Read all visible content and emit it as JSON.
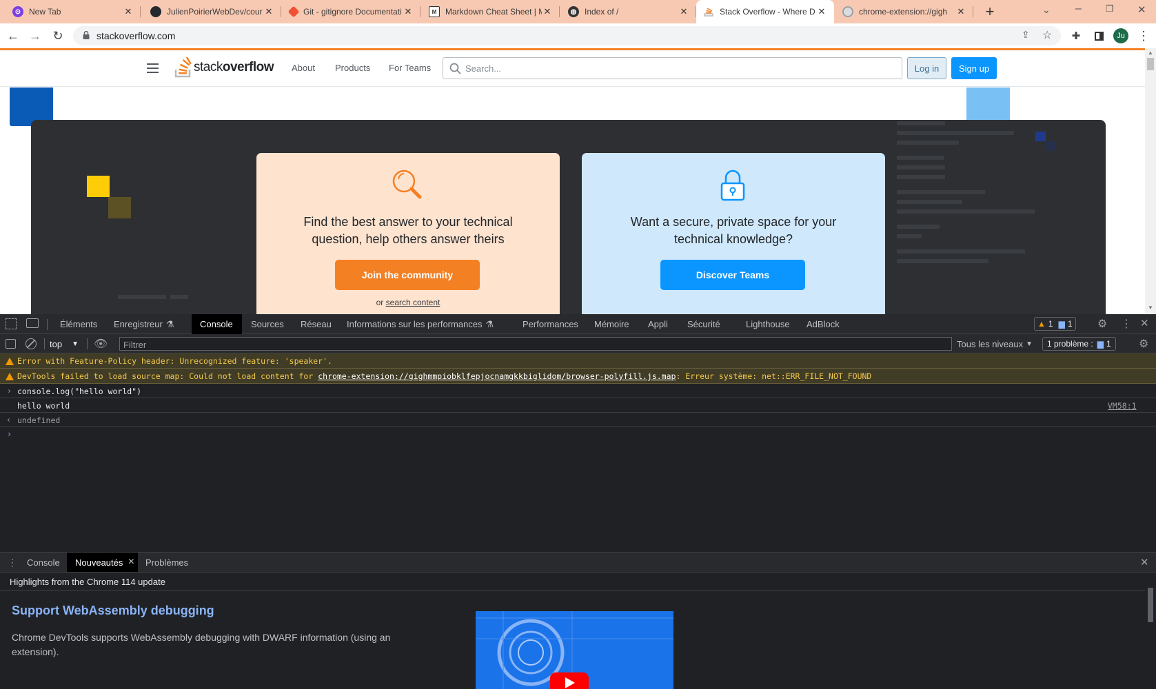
{
  "browser": {
    "tabs": [
      {
        "title": "New Tab",
        "fav_color": "#7b3fe4"
      },
      {
        "title": "JulienPoirierWebDev/cour",
        "fav_color": "#24292f"
      },
      {
        "title": "Git - gitignore Documentati",
        "fav_color": "#f05033"
      },
      {
        "title": "Markdown Cheat Sheet | M",
        "fav_color": "#333333"
      },
      {
        "title": "Index of /",
        "fav_color": "#333333"
      },
      {
        "title": "Stack Overflow - Where D",
        "fav_color": "#f48024"
      },
      {
        "title": "chrome-extension://gigh",
        "fav_color": "#9aa0a6"
      }
    ],
    "new_tab": "+",
    "url": "stackoverflow.com",
    "profile_initials": "Ju"
  },
  "so": {
    "logo_text_a": "stack",
    "logo_text_b": "overflow",
    "nav": [
      "About",
      "Products",
      "For Teams"
    ],
    "search_placeholder": "Search...",
    "login": "Log in",
    "signup": "Sign up",
    "card1": {
      "text": "Find the best answer to your technical question, help others answer theirs",
      "cta": "Join the community",
      "or": "or",
      "link": "search content",
      "bg": "#fee3cf",
      "cta_color": "#f48024"
    },
    "card2": {
      "text": "Want a secure, private space for your technical knowledge?",
      "cta": "Discover Teams",
      "bg": "#cfe8fc",
      "cta_color": "#0a95ff"
    }
  },
  "devtools": {
    "tabs": [
      "Éléments",
      "Enregistreur",
      "Console",
      "Sources",
      "Réseau",
      "Informations sur les performances",
      "Performances",
      "Mémoire",
      "Appli",
      "Sécurité",
      "Lighthouse",
      "AdBlock"
    ],
    "active_tab": "Console",
    "warn_count": "1",
    "info_count": "1",
    "context": "top",
    "filter_placeholder": "Filtrer",
    "levels": "Tous les niveaux",
    "problems": "1 problème :",
    "problems_count": "1",
    "messages": {
      "warn1": "Error with Feature-Policy header: Unrecognized feature: 'speaker'.",
      "warn2_prefix": "DevTools failed to load source map: Could not load content for ",
      "warn2_link": "chrome-extension://gighmmpiobklfepjocnamgkkbiglidom/browser-polyfill.js.map",
      "warn2_suffix": ": Erreur système: net::ERR_FILE_NOT_FOUND",
      "input": "console.log(\"hello world\")",
      "output": "hello world",
      "source": "VM58:1",
      "result": "undefined"
    },
    "drawer": {
      "tabs": [
        "Console",
        "Nouveautés",
        "Problèmes"
      ],
      "active_tab": "Nouveautés",
      "highlight": "Highlights from the Chrome 114 update",
      "feature_title": "Support WebAssembly debugging",
      "feature_text": "Chrome DevTools supports WebAssembly debugging with DWARF information (using an extension)."
    }
  }
}
